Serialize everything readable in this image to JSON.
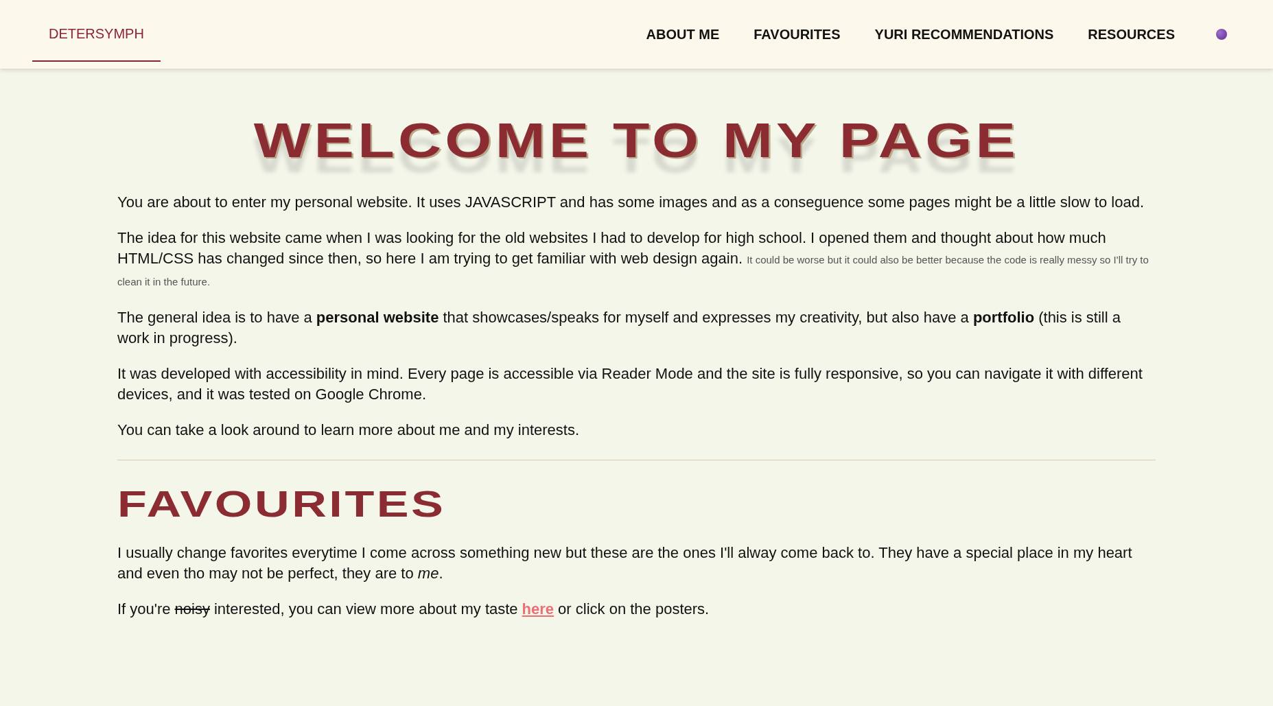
{
  "nav": {
    "brand": {
      "label": "DETERSYMPH",
      "selected": true
    },
    "items": [
      {
        "label": "ABOUT ME",
        "selected": false
      },
      {
        "label": "FAVOURITES",
        "selected": false
      },
      {
        "label": "YURI RECOMMENDATIONS",
        "selected": false
      },
      {
        "label": "RESOURCES",
        "selected": false
      }
    ]
  },
  "welcome": {
    "title": "WELCOME TO MY PAGE",
    "paragraphs": [
      {
        "text": "You are about to enter my personal website. It uses JAVASCRIPT and has some images and as a conseguence some pages might be a little slow to load."
      },
      {
        "text": "The idea for this website came when I was looking for the old websites I had to develop for high school. I opened them and thought about how much HTML/CSS has changed since then, so here I am trying to get familiar with web design again.",
        "note": "It could be worse but it could also be better because the code is really messy so I'll try to clean it in the future."
      },
      {
        "text": "The general idea is to have a **personal website** that showcases/speaks for myself and expresses my creativity, but also have a **portfolio** (this is still a work in progress)."
      },
      {
        "text": "It was developed with accessibility in mind. Every page is accessible via Reader Mode and the site is fully responsive, so you can navigate it with different devices, and it was tested on Google Chrome."
      },
      {
        "text": "You can take a look around to learn more about me and my interests."
      }
    ]
  },
  "favourites": {
    "title": "FAVOURITES",
    "paragraph": "I usually change favorites everytime I come across something new but these are the ones I'll alway come back to. They have a special place in my heart and even tho may not be perfect, they are to *me*.",
    "taste": {
      "before": "If you're",
      "struck": "noisy",
      "middle": "interested, you can view more about my taste",
      "link": "here",
      "after": "or click on the posters."
    }
  }
}
